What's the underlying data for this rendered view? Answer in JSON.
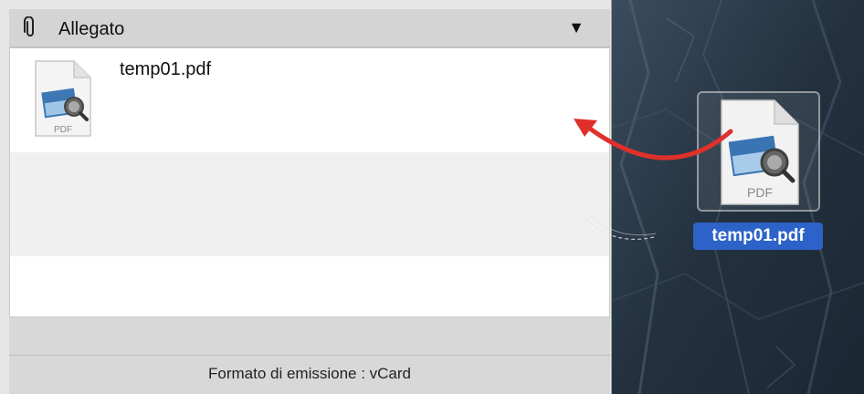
{
  "panel": {
    "header": {
      "title": "Allegato",
      "dropdown_indicator": "▼",
      "icon": "paperclip-icon"
    },
    "files": [
      {
        "name": "temp01.pdf",
        "icon_label": "PDF",
        "icon": "pdf-file-icon"
      }
    ],
    "footer": {
      "text": "Formato di emissione : vCard"
    }
  },
  "desktop": {
    "dragged_file": {
      "name": "temp01.pdf",
      "icon_label": "PDF",
      "icon": "pdf-file-icon"
    },
    "drag_arrow_color": "#e0302a"
  }
}
